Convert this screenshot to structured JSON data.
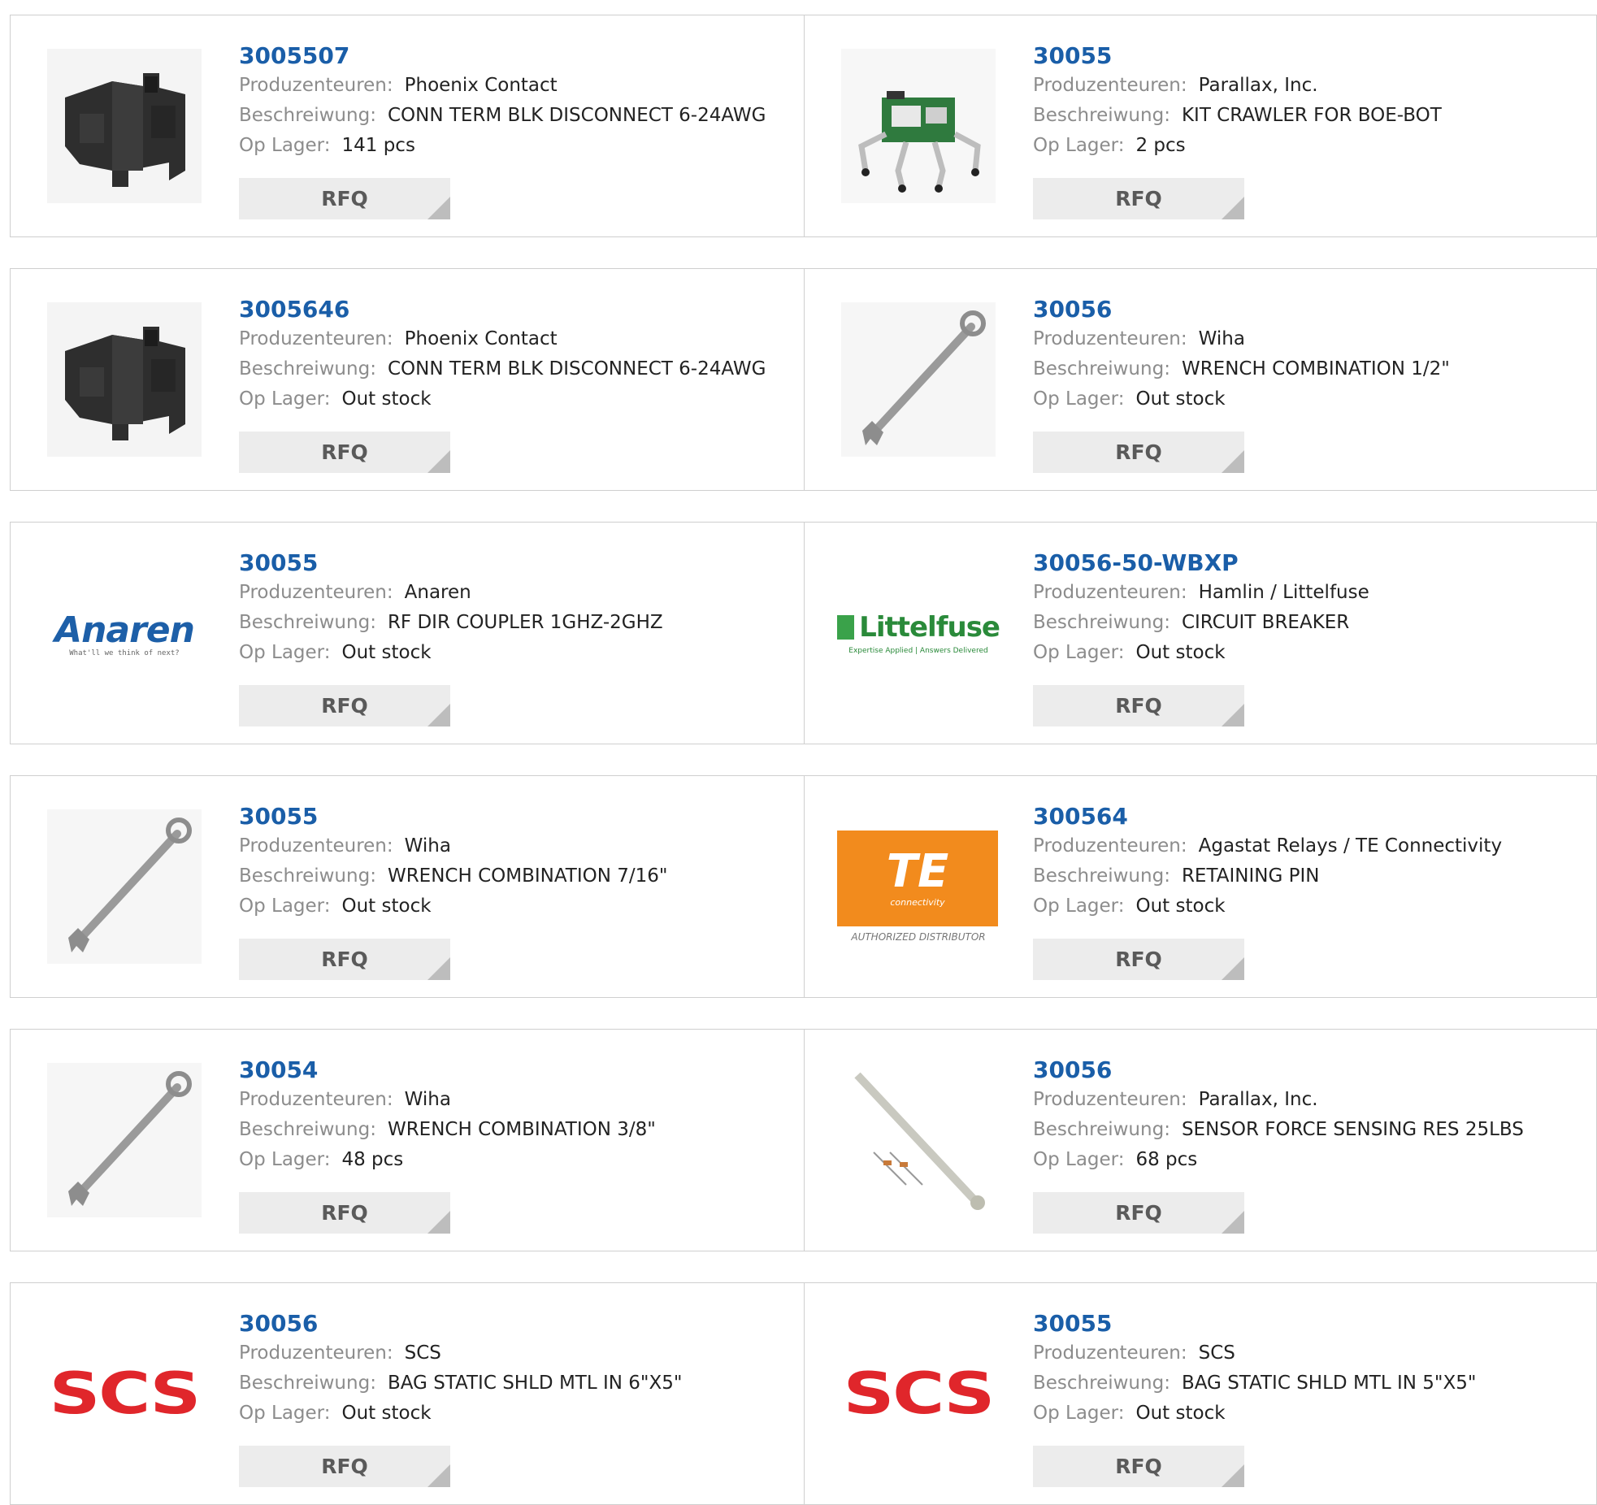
{
  "labels": {
    "manufacturer": "Produzenteuren:",
    "description": "Beschreiwung:",
    "stock": "Op Lager:",
    "rfq": "RFQ"
  },
  "colors": {
    "part_link": "#1a5ea8",
    "label_text": "#8c8c8c",
    "value_text": "#222222",
    "rfq_bg": "#ececec",
    "border": "#cfcfcf"
  },
  "products": [
    {
      "part": "3005507",
      "manufacturer": "Phoenix Contact",
      "description": "CONN TERM BLK DISCONNECT 6-24AWG",
      "stock": "141 pcs",
      "image": "terminal-block-image"
    },
    {
      "part": "30055",
      "manufacturer": "Parallax, Inc.",
      "description": "KIT CRAWLER FOR BOE-BOT",
      "stock": "2 pcs",
      "image": "robot-crawler-image"
    },
    {
      "part": "3005646",
      "manufacturer": "Phoenix Contact",
      "description": "CONN TERM BLK DISCONNECT 6-24AWG",
      "stock": "Out stock",
      "image": "terminal-block-image"
    },
    {
      "part": "30056",
      "manufacturer": "Wiha",
      "description": "WRENCH COMBINATION 1/2\"",
      "stock": "Out stock",
      "image": "wrench-image"
    },
    {
      "part": "30055",
      "manufacturer": "Anaren",
      "description": "RF DIR COUPLER 1GHZ-2GHZ",
      "stock": "Out stock",
      "image": "anaren-logo",
      "logo_text": "Anaren",
      "logo_sub": "What'll we think of next?"
    },
    {
      "part": "30056-50-WBXP",
      "manufacturer": "Hamlin / Littelfuse",
      "description": "CIRCUIT BREAKER",
      "stock": "Out stock",
      "image": "littelfuse-logo",
      "logo_text": "Littelfuse",
      "logo_sub": "Expertise Applied | Answers Delivered"
    },
    {
      "part": "30055",
      "manufacturer": "Wiha",
      "description": "WRENCH COMBINATION 7/16\"",
      "stock": "Out stock",
      "image": "wrench-image"
    },
    {
      "part": "300564",
      "manufacturer": "Agastat Relays / TE Connectivity",
      "description": "RETAINING PIN",
      "stock": "Out stock",
      "image": "te-connectivity-logo",
      "logo_text": "TE",
      "logo_sub": "connectivity",
      "logo_caption": "AUTHORIZED DISTRIBUTOR"
    },
    {
      "part": "30054",
      "manufacturer": "Wiha",
      "description": "WRENCH COMBINATION 3/8\"",
      "stock": "48 pcs",
      "image": "wrench-image"
    },
    {
      "part": "30056",
      "manufacturer": "Parallax, Inc.",
      "description": "SENSOR FORCE SENSING RES 25LBS",
      "stock": "68 pcs",
      "image": "force-sensor-image"
    },
    {
      "part": "30056",
      "manufacturer": "SCS",
      "description": "BAG STATIC SHLD MTL IN 6\"X5\"",
      "stock": "Out stock",
      "image": "scs-logo",
      "logo_text": "SCS"
    },
    {
      "part": "30055",
      "manufacturer": "SCS",
      "description": "BAG STATIC SHLD MTL IN 5\"X5\"",
      "stock": "Out stock",
      "image": "scs-logo",
      "logo_text": "SCS"
    }
  ]
}
